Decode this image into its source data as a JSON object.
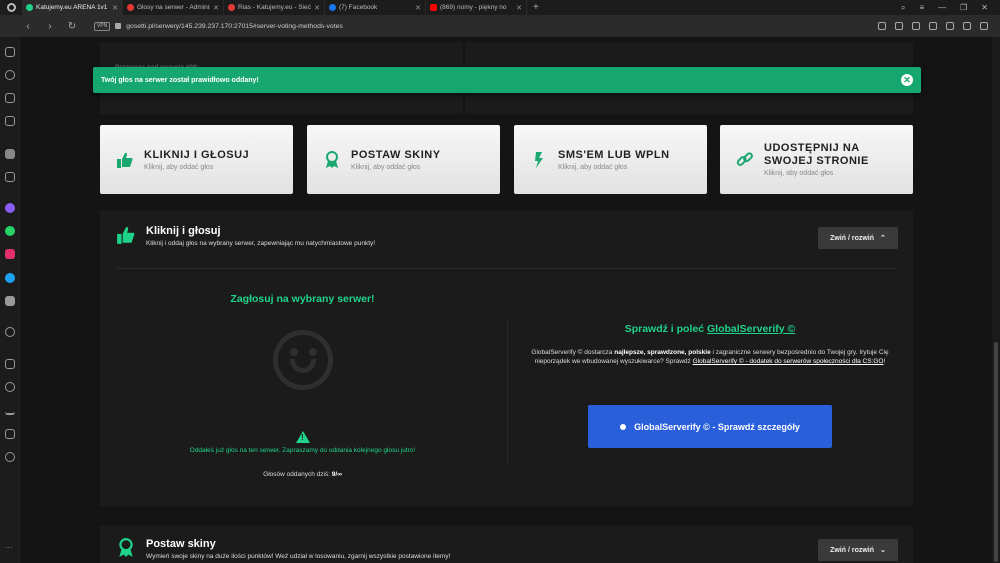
{
  "browser": {
    "tabs": [
      {
        "title": "Katujemy.eu ARENA 1v1 12",
        "active": true,
        "favicon": "#1fd38a"
      },
      {
        "title": "Głosy na serwer - Adminis",
        "active": false,
        "favicon": "#e53935"
      },
      {
        "title": "Rias - Katujemy.eu - Sieć se",
        "active": false,
        "favicon": "#e53935"
      },
      {
        "title": "(7) Facebook",
        "active": false,
        "favicon": "#1877f2"
      },
      {
        "title": "(869) nomy - piękny no",
        "active": false,
        "favicon": "#ff0000"
      }
    ],
    "new_tab": "+",
    "vpn_label": "VPN",
    "url": "gosetti.pl/serwery/145.239.237.170:27015#server-voting-methods-votes"
  },
  "faded": {
    "text": "Przewaga nad pozycją #98:"
  },
  "toast": {
    "message": "Twój głos na serwer został prawidłowo oddany!",
    "close": "✕"
  },
  "cards": [
    {
      "title": "KLIKNIJ I GŁOSUJ",
      "subtitle": "Kliknij, aby oddać głos",
      "icon": "thumbs-up-icon"
    },
    {
      "title": "POSTAW SKINY",
      "subtitle": "Kliknij, aby oddać głos",
      "icon": "award-icon"
    },
    {
      "title": "SMS'EM LUB WPLN",
      "subtitle": "Kliknij, aby oddać głos",
      "icon": "bolt-icon"
    },
    {
      "title": "UDOSTĘPNIJ NA SWOJEJ STRONIE",
      "subtitle": "Kliknij, aby oddać głos",
      "icon": "link-icon"
    }
  ],
  "section_vote": {
    "title": "Kliknij i głosuj",
    "description": "Kliknij i oddaj głos na wybrany serwer, zapewniając mu natychmiastowe punkty!",
    "toggle_label": "Zwiń / rozwiń",
    "left_title": "Zagłosuj na wybrany serwer!",
    "done_message": "Oddałeś już głos na ten serwer. Zapraszamy do oddania kolejnego głosu jutro!",
    "count_label": "Głosów oddanych dziś:",
    "count_value": "9/∞",
    "right_title_prefix": "Sprawdź i poleć",
    "right_title_link": "GlobalServerify ©",
    "right_desc_1": "GlobalServerify © dostarcza",
    "right_desc_bold": "najlepsze, sprawdzone, polskie",
    "right_desc_2": "i zagraniczne serwery bezpośrednio do Twojej gry.",
    "right_desc_3": "Irytuje Cię nieporządek we wbudowanej wyszukiwarce? Sprawdź",
    "right_desc_link": "GlobalServerify © - dodatek do serwerów społeczności dla CS:GO",
    "right_desc_end": "!",
    "cta_label": "GlobalServerify © - Sprawdź szczegóły"
  },
  "section_skins": {
    "title": "Postaw skiny",
    "description": "Wymień swoje skiny na duże ilości punktów! Weź udział w losowaniu, zgarnij wszystkie postawione itemy!",
    "toggle_label": "Zwiń / rozwiń"
  },
  "colors": {
    "accent": "#1fd38a",
    "toast": "#16a66f",
    "cta": "#2a5fdc"
  }
}
